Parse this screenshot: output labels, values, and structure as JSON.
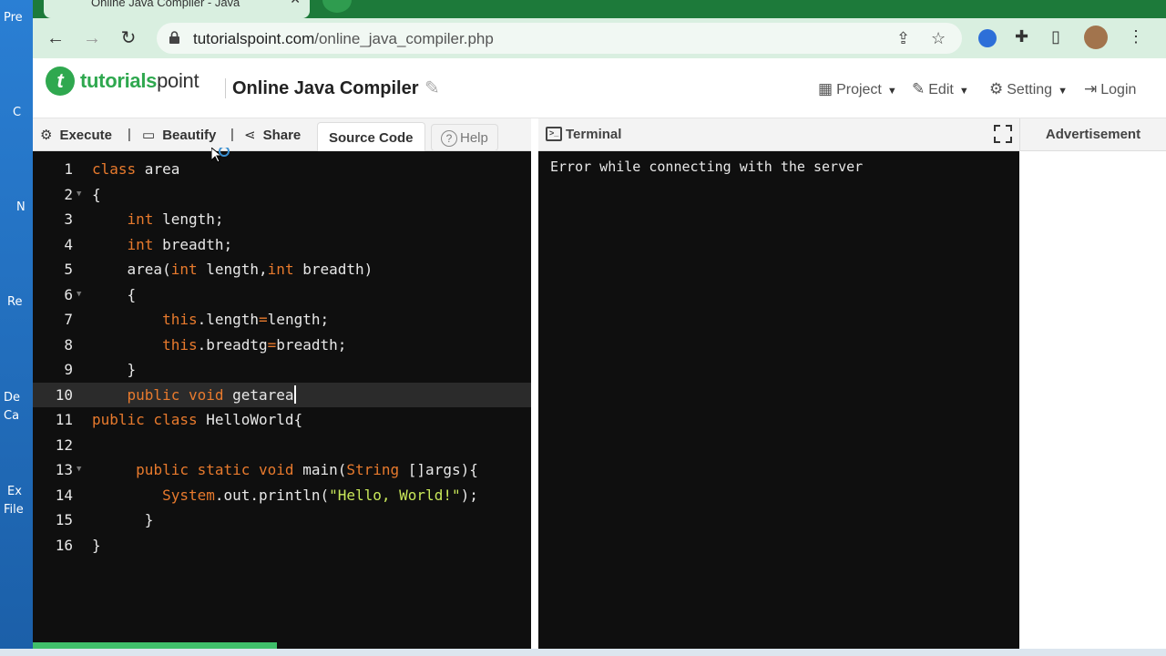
{
  "desktop": {
    "labels": [
      "Pre",
      "C",
      "N",
      "Re",
      "De",
      "Ca",
      "Ex",
      "File"
    ]
  },
  "browser": {
    "tab_title": "Online Java Compiler - Java",
    "url_host": "tutorialspoint.com",
    "url_path": "/online_java_compiler.php"
  },
  "header": {
    "logo_bold": "tutorials",
    "logo_thin": "point",
    "title": "Online Java Compiler",
    "menus": [
      {
        "label": "Project",
        "icon": "grid-icon"
      },
      {
        "label": "Edit",
        "icon": "edit-icon"
      },
      {
        "label": "Setting",
        "icon": "gear-icon"
      },
      {
        "label": "Login",
        "icon": "login-icon"
      }
    ]
  },
  "editor_toolbar": {
    "execute": "Execute",
    "sep": "|",
    "beautify": "Beautify",
    "share": "Share",
    "source_code": "Source Code",
    "help": "Help"
  },
  "editor": {
    "active_line": 10,
    "lines": [
      {
        "n": "1",
        "fold": false
      },
      {
        "n": "2",
        "fold": true
      },
      {
        "n": "3",
        "fold": false
      },
      {
        "n": "4",
        "fold": false
      },
      {
        "n": "5",
        "fold": false
      },
      {
        "n": "6",
        "fold": true
      },
      {
        "n": "7",
        "fold": false
      },
      {
        "n": "8",
        "fold": false
      },
      {
        "n": "9",
        "fold": false
      },
      {
        "n": "10",
        "fold": false
      },
      {
        "n": "11",
        "fold": false
      },
      {
        "n": "12",
        "fold": false
      },
      {
        "n": "13",
        "fold": true
      },
      {
        "n": "14",
        "fold": false
      },
      {
        "n": "15",
        "fold": false
      },
      {
        "n": "16",
        "fold": false
      }
    ],
    "code": {
      "l1_kw": "class",
      "l1_rest": " area",
      "l2": "{",
      "l3_kw": "int",
      "l3_rest": " length;",
      "l4_kw": "int",
      "l4_rest": " breadth;",
      "l5_a": "area(",
      "l5_kw1": "int",
      "l5_b": " length,",
      "l5_kw2": "int",
      "l5_c": " breadth)",
      "l6": "{",
      "l7_kw": "this",
      "l7_a": ".length",
      "l7_op": "=",
      "l7_b": "length;",
      "l8_kw": "this",
      "l8_a": ".breadtg",
      "l8_op": "=",
      "l8_b": "breadth;",
      "l9": "}",
      "l10_kw": "public void",
      "l10_rest": " getarea",
      "l11_kw": "public class",
      "l11_rest": " HelloWorld{",
      "l13_kw": "public static void",
      "l13_a": " main(",
      "l13_type": "String",
      "l13_b": " []args){",
      "l14_a": "System",
      "l14_b": ".out.println(",
      "l14_str": "\"Hello, World!\"",
      "l14_c": ");",
      "l15": "}",
      "l16": "}"
    }
  },
  "terminal": {
    "label": "Terminal",
    "output": "Error while connecting with the server"
  },
  "advertisement": {
    "label": "Advertisement"
  },
  "colors": {
    "keyword": "#e87a2d",
    "string": "#c9e85a",
    "brand": "#2fa84f"
  }
}
